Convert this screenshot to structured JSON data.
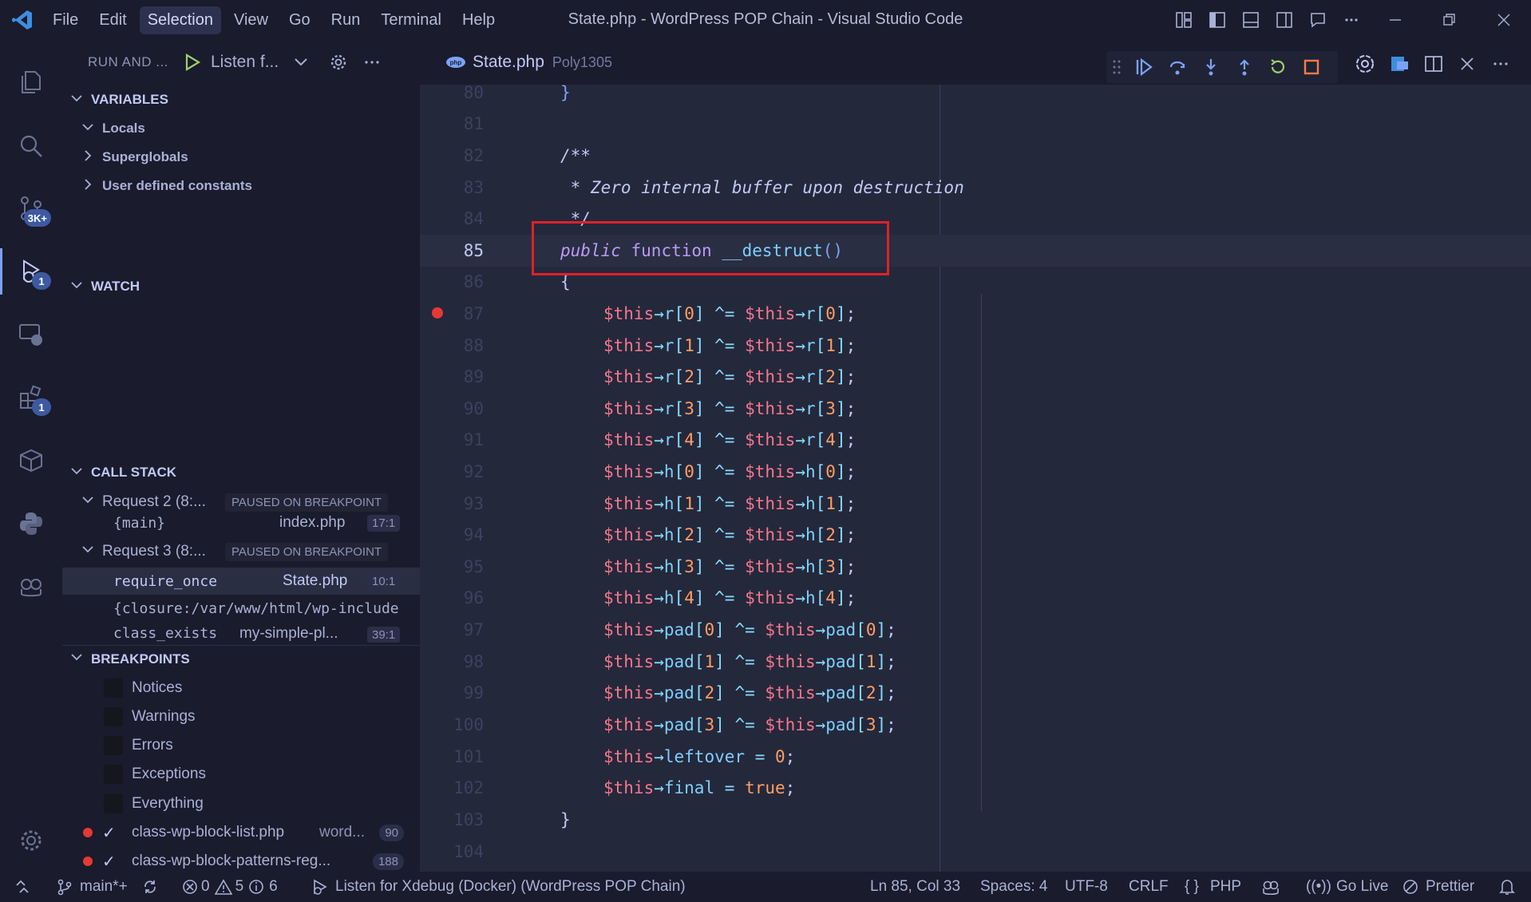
{
  "window": {
    "title": "State.php - WordPress POP Chain - Visual Studio Code",
    "menu": [
      "File",
      "Edit",
      "Selection",
      "View",
      "Go",
      "Run",
      "Terminal",
      "Help"
    ],
    "active_menu": "Selection"
  },
  "activity": {
    "scm_badge": "3K+",
    "debug_badge": "1",
    "extensions_badge": "1"
  },
  "sidebar": {
    "header": "RUN AND ...",
    "config": "Listen f...",
    "variables": {
      "title": "VARIABLES",
      "items": [
        "Locals",
        "Superglobals",
        "User defined constants"
      ]
    },
    "watch": {
      "title": "WATCH"
    },
    "call_stack": {
      "title": "CALL STACK",
      "requests": [
        {
          "name": "Request 2 (8:...",
          "status": "PAUSED ON BREAKPOINT"
        },
        {
          "name": "Request 3 (8:...",
          "status": "PAUSED ON BREAKPOINT"
        }
      ],
      "frames": [
        {
          "fn": "{main}",
          "file": "index.php",
          "pos": "17:1"
        },
        {
          "fn": "require_once",
          "file": "State.php",
          "pos": "10:1"
        },
        {
          "fn": "{closure:/var/www/html/wp-include",
          "file": "",
          "pos": ""
        },
        {
          "fn": "class_exists",
          "file": "my-simple-pl...",
          "pos": "39:1"
        }
      ]
    },
    "breakpoints": {
      "title": "BREAKPOINTS",
      "exceptions": [
        "Notices",
        "Warnings",
        "Errors",
        "Exceptions",
        "Everything"
      ],
      "files": [
        {
          "name": "class-wp-block-list.php",
          "dir": "word...",
          "line": "90"
        },
        {
          "name": "class-wp-block-patterns-reg...",
          "dir": "",
          "line": "188"
        }
      ]
    }
  },
  "editor": {
    "tab": {
      "name": "State.php",
      "desc": "Poly1305"
    },
    "line_numbers": [
      "80",
      "81",
      "82",
      "83",
      "84",
      "85",
      "86",
      "87",
      "88",
      "89",
      "90",
      "91",
      "92",
      "93",
      "94",
      "95",
      "96",
      "97",
      "98",
      "99",
      "100",
      "101",
      "102",
      "103",
      "104"
    ],
    "current_line": "85",
    "breakpoint_line": "87",
    "comment_open": "/**",
    "comment_text": " * Zero internal buffer upon destruction",
    "comment_close": " */",
    "decl_public": "public",
    "decl_function": "function",
    "decl_name": "__destruct",
    "decl_parens": "()",
    "brace_open": "{",
    "brace_close": "}",
    "assign_lines": [
      {
        "prop": "r",
        "idx": "0"
      },
      {
        "prop": "r",
        "idx": "1"
      },
      {
        "prop": "r",
        "idx": "2"
      },
      {
        "prop": "r",
        "idx": "3"
      },
      {
        "prop": "r",
        "idx": "4"
      },
      {
        "prop": "h",
        "idx": "0"
      },
      {
        "prop": "h",
        "idx": "1"
      },
      {
        "prop": "h",
        "idx": "2"
      },
      {
        "prop": "h",
        "idx": "3"
      },
      {
        "prop": "h",
        "idx": "4"
      },
      {
        "prop": "pad",
        "idx": "0"
      },
      {
        "prop": "pad",
        "idx": "1"
      },
      {
        "prop": "pad",
        "idx": "2"
      },
      {
        "prop": "pad",
        "idx": "3"
      }
    ],
    "this_var": "$this",
    "arrow": "→",
    "xor_assign": "^=",
    "leftover_line": {
      "prop": "leftover",
      "value": "0"
    },
    "final_line": {
      "prop": "final",
      "value": "true"
    }
  },
  "status": {
    "branch": "main*+",
    "errors": "0",
    "warnings": "5",
    "infos": "6",
    "debug_session": "Listen for Xdebug (Docker) (WordPress POP Chain)",
    "cursor": "Ln 85, Col 33",
    "spaces": "Spaces: 4",
    "encoding": "UTF-8",
    "eol": "CRLF",
    "language": "PHP",
    "golive": "Go Live",
    "prettier": "Prettier"
  },
  "colors": {
    "editor_bg": "#24283b",
    "sidebar_bg": "#1a1b2c",
    "accent": "#7aa2f7",
    "highlight_box": "#e0202a",
    "breakpoint": "#e53935"
  }
}
